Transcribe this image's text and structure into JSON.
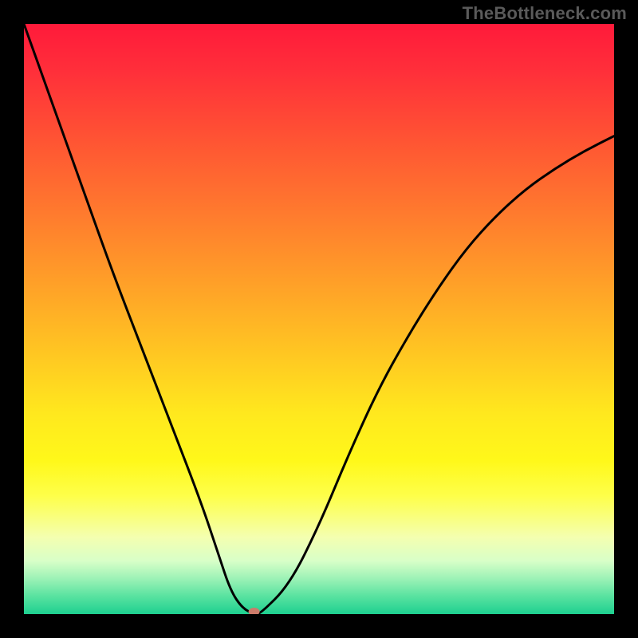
{
  "watermark": "TheBottleneck.com",
  "chart_data": {
    "type": "line",
    "title": "",
    "xlabel": "",
    "ylabel": "",
    "xlim": [
      0,
      100
    ],
    "ylim": [
      0,
      100
    ],
    "grid": false,
    "legend": false,
    "series": [
      {
        "name": "bottleneck-curve",
        "x": [
          0,
          5,
          10,
          15,
          20,
          25,
          30,
          33,
          35,
          37,
          39,
          40,
          45,
          50,
          55,
          60,
          65,
          70,
          75,
          80,
          85,
          90,
          95,
          100
        ],
        "values": [
          100,
          86,
          72,
          58,
          45,
          32,
          19,
          10,
          4,
          1,
          0,
          0,
          5,
          15,
          27,
          38,
          47,
          55,
          62,
          67.5,
          72,
          75.5,
          78.5,
          81
        ]
      }
    ],
    "annotations": [
      {
        "name": "optimal-point",
        "x": 39,
        "y": 0
      }
    ],
    "background_gradient": {
      "orientation": "vertical",
      "stops": [
        {
          "pos": 0.0,
          "color": "#ff1a3a"
        },
        {
          "pos": 0.5,
          "color": "#ffd020"
        },
        {
          "pos": 0.8,
          "color": "#feff4a"
        },
        {
          "pos": 1.0,
          "color": "#1ed090"
        }
      ]
    }
  }
}
